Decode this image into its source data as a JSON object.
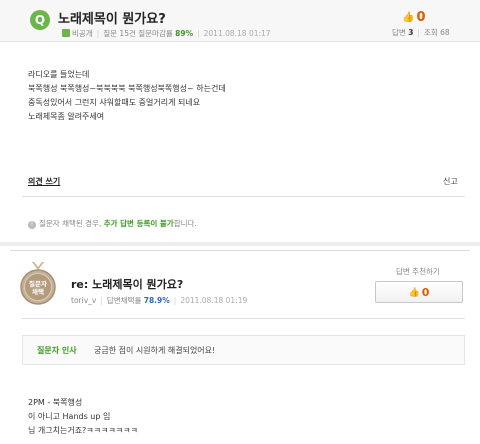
{
  "question": {
    "icon_letter": "Q",
    "title": "노래제목이 뭔가요?",
    "author": "비공개",
    "meta_prefix": "질문 15건 질문마감률",
    "close_rate": "89%",
    "date": "2011.08.18 01:17",
    "thumb_count": "0",
    "answers_label": "답변",
    "answers_count": "3",
    "views_label": "조회",
    "views_count": "68",
    "body_lines": [
      "라디오를 들었는데",
      "북쪽행성 북쪽행성~북북북북 북쪽행성북쪽행성~ 하는건데",
      "중독성있어서 그런지 샤워할때도 중얼거리게 되네요",
      "노래제목좀 알려주세여"
    ],
    "opinion_label": "의견 쓰기",
    "report_label": "신고",
    "notice": {
      "before": "질문자 채택된 경우, ",
      "highlight": "추가 답변 등록이 불가",
      "after": "합니다."
    }
  },
  "answer": {
    "medal_line1": "질문자",
    "medal_line2": "채택",
    "title": "re: 노래제목이 뭔가요?",
    "author": "toriv_v",
    "rate_label": "답변채택률",
    "rate": "78.9%",
    "date": "2011.08.18 01:19",
    "recommend_label": "답변 추천하기",
    "recommend_count": "0",
    "comment_label": "질문자 인사",
    "comment_text": "궁금한 점이 시원하게 해결되었어요!",
    "body_lines": [
      "2PM - 북쪽행성",
      "이 아니고 Hands up 임",
      "님 개그치는거죠?ㅋㅋㅋㅋㅋㅋㅋ"
    ]
  },
  "colors": {
    "accent_green": "#6bb54a",
    "count_orange": "#e05a00",
    "link_blue": "#2d68c4",
    "medal_bronze": "#b49b7e"
  }
}
